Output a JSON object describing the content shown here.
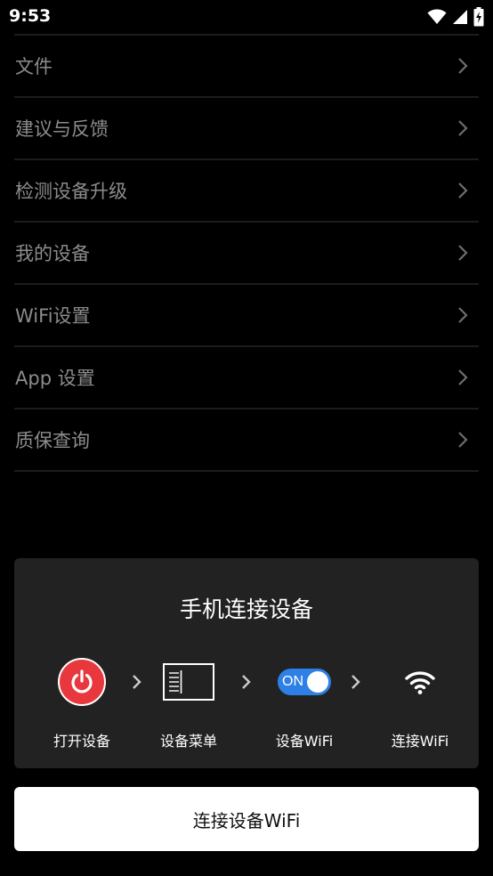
{
  "status_bar": {
    "time": "9:53",
    "icons": [
      "wifi-icon",
      "cellular-signal-icon",
      "battery-charging-icon"
    ]
  },
  "menu": {
    "items": [
      {
        "label": "文件"
      },
      {
        "label": "建议与反馈"
      },
      {
        "label": "检测设备升级"
      },
      {
        "label": "我的设备"
      },
      {
        "label": "WiFi设置"
      },
      {
        "label": "App 设置"
      },
      {
        "label": "质保查询"
      }
    ],
    "chevron_icon": "chevron-right-icon"
  },
  "guide": {
    "title": "手机连接设备",
    "steps": [
      {
        "label": "打开设备",
        "icon": "power-icon"
      },
      {
        "label": "设备菜单",
        "icon": "device-menu-icon"
      },
      {
        "label": "设备WiFi",
        "icon": "toggle-on-icon",
        "toggle_text": "ON"
      },
      {
        "label": "连接WiFi",
        "icon": "wifi-icon"
      }
    ]
  },
  "connect_button": {
    "label": "连接设备WiFi"
  },
  "colors": {
    "background": "#000000",
    "card": "#222222",
    "menu_text": "#8c8c8c",
    "divider": "#1c1c1c",
    "power_red": "#e8383d",
    "toggle_blue": "#2e80e6",
    "button_bg": "#ffffff"
  }
}
